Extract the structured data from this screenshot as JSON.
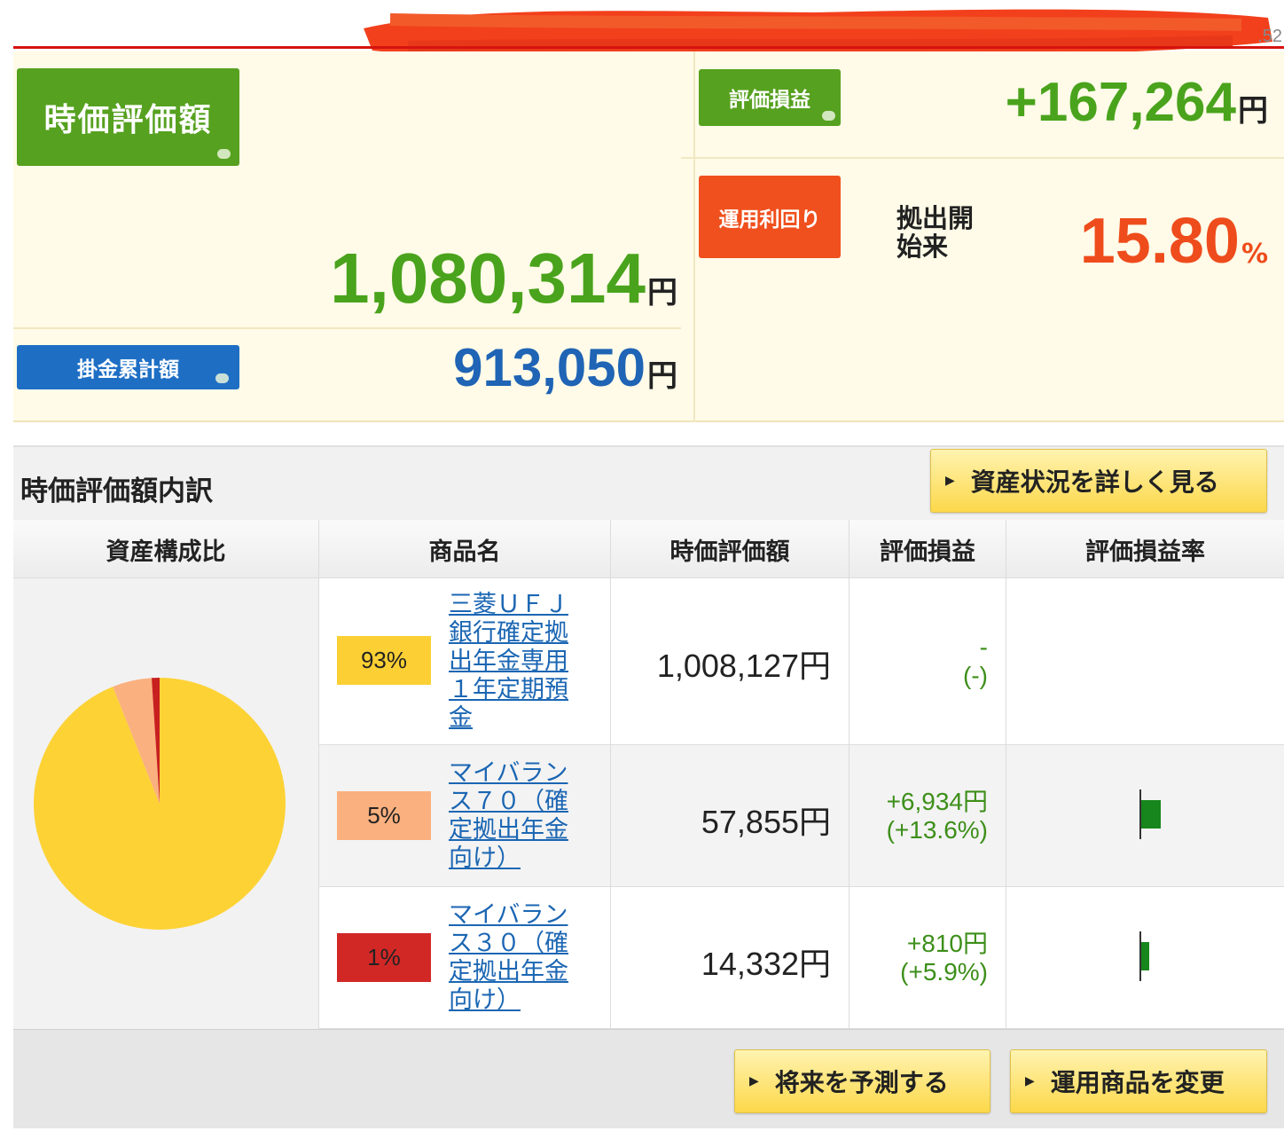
{
  "top": {
    "corner_text": ".52"
  },
  "summary": {
    "market_value_label": "時価評価額",
    "market_value": "1,080,314",
    "contribution_label": "掛金累計額",
    "contribution_value": "913,050",
    "gain_label": "評価損益",
    "gain_value": "+167,264",
    "yield_label": "運用利回り",
    "yield_period": "拠出開始来",
    "yield_value": "15.80",
    "yield_unit": "%",
    "currency": "円"
  },
  "breakdown": {
    "title": "時価評価額内訳",
    "detail_button": "資産状況を詳しく見る",
    "columns": [
      "資産構成比",
      "商品名",
      "時価評価額",
      "評価損益",
      "評価損益率"
    ],
    "rows": [
      {
        "share": "93%",
        "share_color": "#fcd034",
        "name": "三菱ＵＦＪ銀行確定拠出年金専用１年定期預金",
        "value": "1,008,127円",
        "gain": "-",
        "gain_rate": "(-)",
        "bar_fraction": 0
      },
      {
        "share": "5%",
        "share_color": "#fbb07f",
        "name": "マイバランス７０（確定拠出年金向け）",
        "value": "57,855円",
        "gain": "+6,934円",
        "gain_rate": "(+13.6%)",
        "bar_fraction": 1.0
      },
      {
        "share": "1%",
        "share_color": "#d12826",
        "name": "マイバランス３０（確定拠出年金向け）",
        "value": "14,332円",
        "gain": "+810円",
        "gain_rate": "(+5.9%)",
        "bar_fraction": 0.43
      }
    ]
  },
  "pie": {
    "slices": [
      {
        "fraction": 0.93,
        "color": "#fdd235"
      },
      {
        "fraction": 0.05,
        "color": "#fbb07f"
      },
      {
        "fraction": 0.01,
        "color": "#c8201e"
      }
    ]
  },
  "footer": {
    "forecast_button": "将来を予測する",
    "change_button": "運用商品を変更"
  }
}
